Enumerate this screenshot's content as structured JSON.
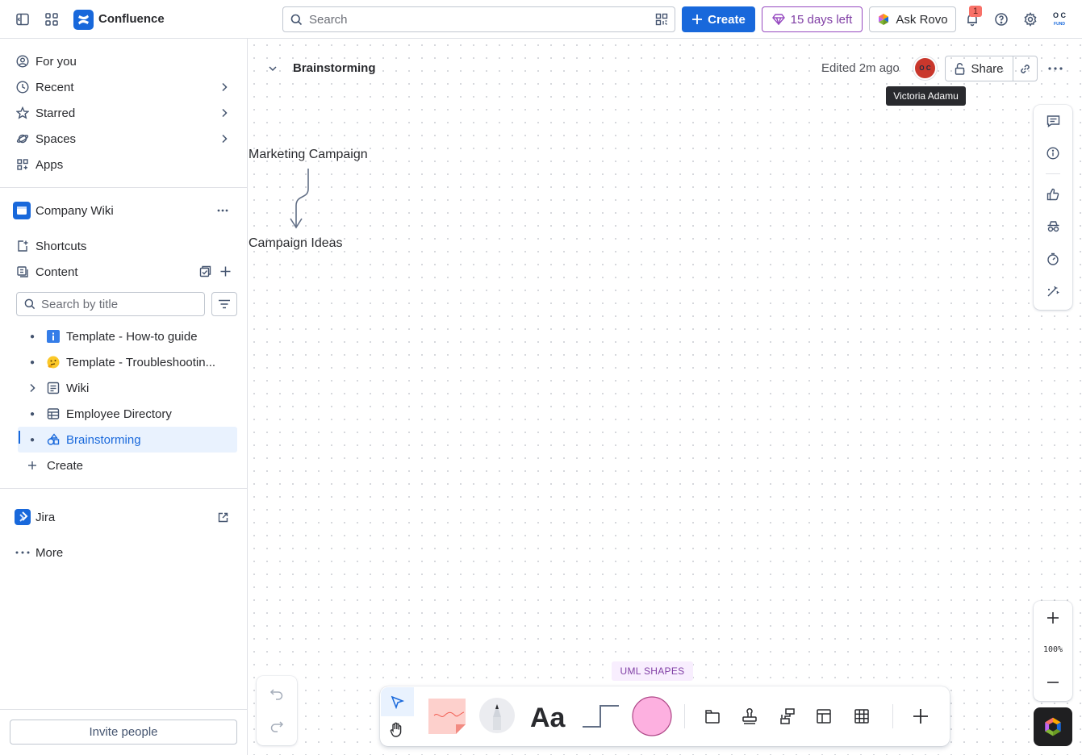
{
  "topbar": {
    "app_name": "Confluence",
    "search_placeholder": "Search",
    "create_label": "Create",
    "trial_label": "15 days left",
    "rovo_label": "Ask Rovo",
    "notification_count": "1",
    "profile_initials": "O C",
    "profile_sub": "FUND"
  },
  "sidebar": {
    "nav": [
      {
        "label": "For you",
        "icon": "user-circle-icon"
      },
      {
        "label": "Recent",
        "icon": "clock-icon"
      },
      {
        "label": "Starred",
        "icon": "star-icon"
      },
      {
        "label": "Spaces",
        "icon": "planet-icon"
      },
      {
        "label": "Apps",
        "icon": "apps-icon"
      }
    ],
    "space_name": "Company Wiki",
    "shortcuts_label": "Shortcuts",
    "content_label": "Content",
    "title_search_placeholder": "Search by title",
    "tree": [
      {
        "label": "Template - How-to guide",
        "icon": "info-icon"
      },
      {
        "label": "Template - Troubleshootin...",
        "icon": "thinking-face-icon"
      },
      {
        "label": "Wiki",
        "icon": "page-icon"
      },
      {
        "label": "Employee Directory",
        "icon": "table-icon"
      },
      {
        "label": "Brainstorming",
        "icon": "whiteboard-icon"
      }
    ],
    "tree_create_label": "Create",
    "jira_label": "Jira",
    "more_label": "More",
    "invite_label": "Invite people"
  },
  "page": {
    "title": "Brainstorming",
    "edited": "Edited 2m ago",
    "avatar_initials": "O C",
    "share_label": "Share",
    "tooltip": "Victoria Adamu"
  },
  "canvas": {
    "node_top": "Marketing Campaign",
    "node_bottom": "Campaign Ideas",
    "zoom_level": "100%",
    "uml_label": "UML SHAPES"
  },
  "colors": {
    "brand": "#1868db",
    "trial": "#803fa5",
    "sticky": "#fdd0cc",
    "shape_fill": "#fdb0e0",
    "avatar": "#c9372c"
  }
}
